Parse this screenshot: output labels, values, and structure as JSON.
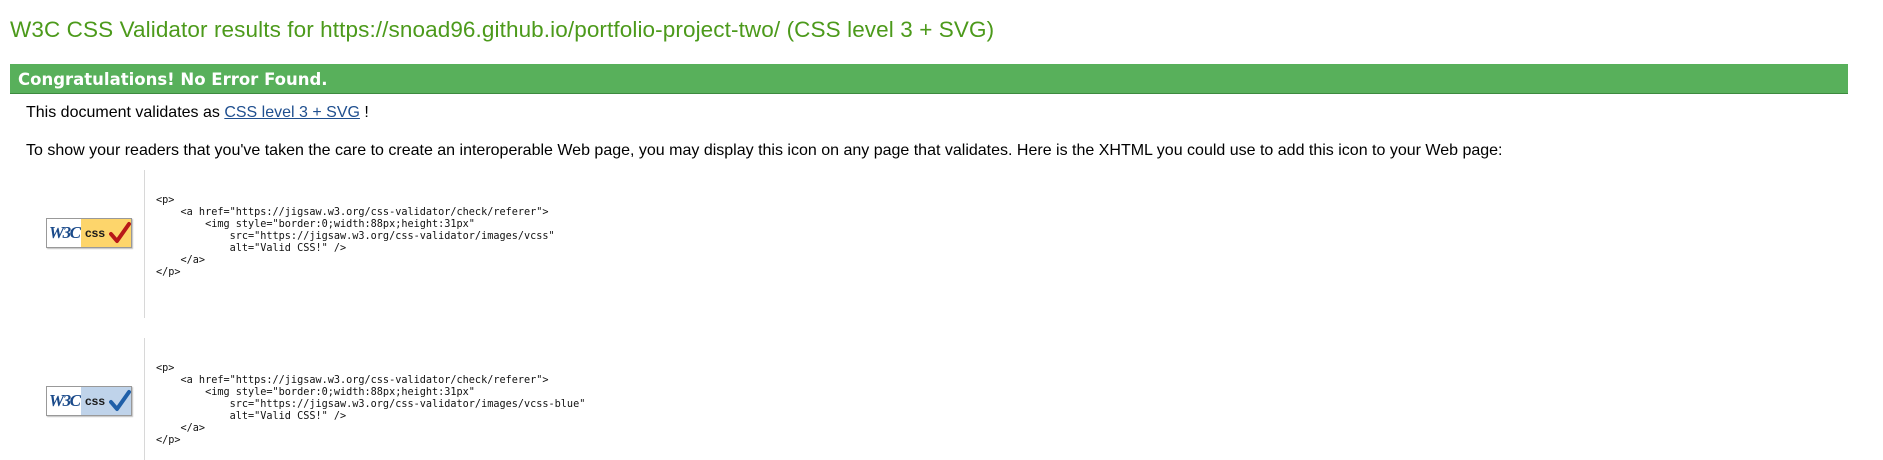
{
  "page": {
    "title": "W3C CSS Validator results for https://snoad96.github.io/portfolio-project-two/ (CSS level 3 + SVG)"
  },
  "banner": {
    "text": "Congratulations! No Error Found."
  },
  "validation": {
    "prefix": "This document validates as ",
    "profile_link": "CSS level 3 + SVG",
    "suffix": " !",
    "info": "To show your readers that you've taken the care to create an interoperable Web page, you may display this icon on any page that validates. Here is the XHTML you could use to add this icon to your Web page:"
  },
  "badges": [
    {
      "logo": "W3C",
      "label": "css",
      "icon": "checkmark-red-icon",
      "color": "#fdd56b",
      "code": "<p>\n    <a href=\"https://jigsaw.w3.org/css-validator/check/referer\">\n        <img style=\"border:0;width:88px;height:31px\"\n            src=\"https://jigsaw.w3.org/css-validator/images/vcss\"\n            alt=\"Valid CSS!\" />\n    </a>\n</p>"
    },
    {
      "logo": "W3C",
      "label": "css",
      "icon": "checkmark-blue-icon",
      "color": "#bfd3ea",
      "code": "<p>\n    <a href=\"https://jigsaw.w3.org/css-validator/check/referer\">\n        <img style=\"border:0;width:88px;height:31px\"\n            src=\"https://jigsaw.w3.org/css-validator/images/vcss-blue\"\n            alt=\"Valid CSS!\" />\n    </a>\n</p>"
    }
  ]
}
